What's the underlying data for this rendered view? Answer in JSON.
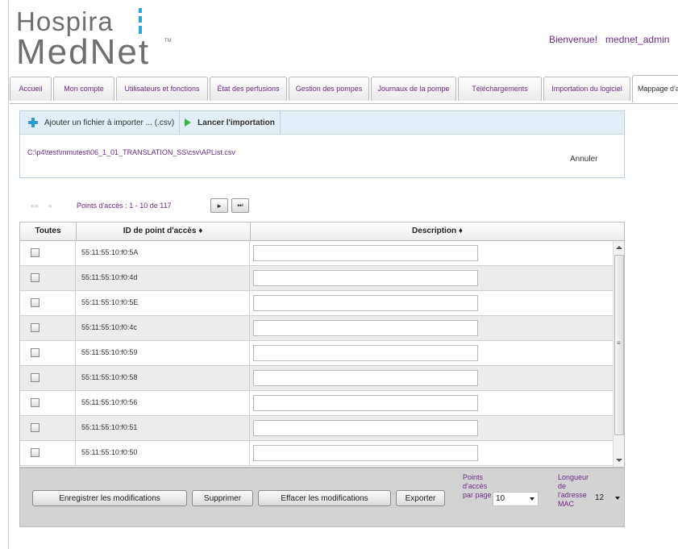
{
  "brand": {
    "line1": "Hospira",
    "line2": "MedNet",
    "tm": "TM",
    "accent": "#2aa8d8"
  },
  "header": {
    "welcome": "Bienvenue!",
    "user": "mednet_admin"
  },
  "tabs": [
    {
      "label": "Accueil"
    },
    {
      "label": "Mon compte"
    },
    {
      "label": "Utilisateurs et fonctions"
    },
    {
      "label": "État des perfusions"
    },
    {
      "label": "Gestion des pompes"
    },
    {
      "label": "Journaux de la pompe"
    },
    {
      "label": "Téléchargements"
    },
    {
      "label": "Importation du logiciel"
    },
    {
      "label": "Mappage d'a"
    }
  ],
  "import": {
    "add_label": "Ajouter un fichier à importer ... (.csv)",
    "launch_label": "Lancer l'importation",
    "file_path": "C:\\p4\\test\\mmutest\\06_1_01_TRANSLATION_SS\\csv\\APList.csv",
    "cancel_label": "Annuler"
  },
  "pager": {
    "first": "««",
    "prev": "«",
    "info": "Points d'accès : 1 - 10 de 117",
    "next": "►",
    "last": "⏭"
  },
  "table": {
    "headers": {
      "select": "Toutes",
      "id": "ID de point d'accès ♦",
      "description": "Description ♦"
    },
    "rows": [
      {
        "mac": "55:11:55:10:f0:5A",
        "description": ""
      },
      {
        "mac": "55:11:55:10:f0:4d",
        "description": ""
      },
      {
        "mac": "55:11:55:10:f0:5E",
        "description": ""
      },
      {
        "mac": "55:11:55:10:f0:4c",
        "description": ""
      },
      {
        "mac": "55:11:55:10:f0:59",
        "description": ""
      },
      {
        "mac": "55:11:55:10:f0:58",
        "description": ""
      },
      {
        "mac": "55:11:55:10:f0:56",
        "description": ""
      },
      {
        "mac": "55:11:55:10:f0:51",
        "description": ""
      },
      {
        "mac": "55:11:55:10:f0:50",
        "description": ""
      }
    ]
  },
  "footer": {
    "save": "Enregistrer les modifications",
    "delete": "Supprimer",
    "clear": "Effacer les modifications",
    "export": "Exporter",
    "per_page_label": "Points d'accès par page",
    "per_page_value": "10",
    "mac_length_label": "Longueur de l'adresse MAC",
    "mac_length_value": "12"
  },
  "colors": {
    "link": "#6a2b83",
    "panel": "#e4eef8",
    "footer": "#d3d3d3"
  }
}
